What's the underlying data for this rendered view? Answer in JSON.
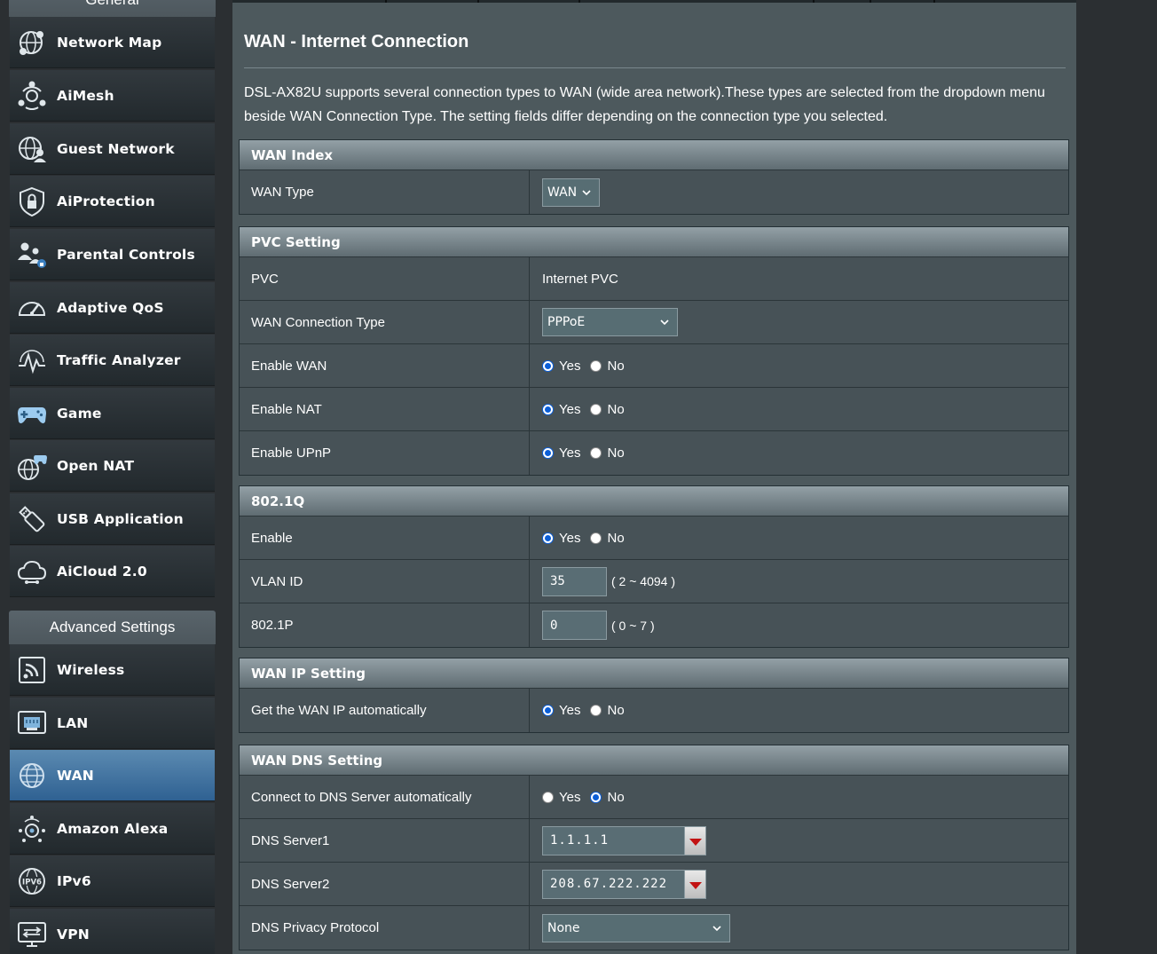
{
  "sidebar": {
    "general_header": "General",
    "advanced_header": "Advanced Settings",
    "general_items": [
      {
        "label": "Network Map",
        "icon": "network-map-icon"
      },
      {
        "label": "AiMesh",
        "icon": "aimesh-icon"
      },
      {
        "label": "Guest Network",
        "icon": "guest-network-icon"
      },
      {
        "label": "AiProtection",
        "icon": "shield-lock-icon"
      },
      {
        "label": "Parental Controls",
        "icon": "parental-controls-icon"
      },
      {
        "label": "Adaptive QoS",
        "icon": "speedometer-icon"
      },
      {
        "label": "Traffic Analyzer",
        "icon": "traffic-analyzer-icon"
      },
      {
        "label": "Game",
        "icon": "gamepad-icon"
      },
      {
        "label": "Open NAT",
        "icon": "open-nat-icon"
      },
      {
        "label": "USB Application",
        "icon": "usb-icon"
      },
      {
        "label": "AiCloud 2.0",
        "icon": "cloud-icon"
      }
    ],
    "advanced_items": [
      {
        "label": "Wireless",
        "icon": "wireless-icon"
      },
      {
        "label": "LAN",
        "icon": "lan-icon"
      },
      {
        "label": "WAN",
        "icon": "globe-icon",
        "active": true
      },
      {
        "label": "Amazon Alexa",
        "icon": "alexa-icon"
      },
      {
        "label": "IPv6",
        "icon": "ipv6-icon"
      },
      {
        "label": "VPN",
        "icon": "vpn-icon"
      }
    ]
  },
  "main": {
    "title": "WAN - Internet Connection",
    "description": "DSL-AX82U supports several connection types to WAN (wide area network).These types are selected from the dropdown menu beside WAN Connection Type. The setting fields differ depending on the connection type you selected."
  },
  "radio_labels": {
    "yes": "Yes",
    "no": "No"
  },
  "wan_index": {
    "header": "WAN Index",
    "wan_type_label": "WAN Type",
    "wan_type_value": "WAN"
  },
  "pvc_setting": {
    "header": "PVC Setting",
    "pvc_label": "PVC",
    "pvc_value": "Internet PVC",
    "conn_type_label": "WAN Connection Type",
    "conn_type_value": "PPPoE",
    "enable_wan_label": "Enable WAN",
    "enable_wan": "yes",
    "enable_nat_label": "Enable NAT",
    "enable_nat": "yes",
    "enable_upnp_label": "Enable UPnP",
    "enable_upnp": "yes"
  },
  "dot1q": {
    "header": "802.1Q",
    "enable_label": "Enable",
    "enable": "yes",
    "vlan_label": "VLAN ID",
    "vlan_value": "35",
    "vlan_hint": "( 2 ~ 4094 )",
    "p_label": "802.1P",
    "p_value": "0",
    "p_hint": "( 0 ~ 7 )"
  },
  "wan_ip": {
    "header": "WAN IP Setting",
    "auto_label": "Get the WAN IP automatically",
    "auto": "yes"
  },
  "wan_dns": {
    "header": "WAN DNS Setting",
    "auto_label": "Connect to DNS Server automatically",
    "auto": "no",
    "dns1_label": "DNS Server1",
    "dns1_value": "1.1.1.1",
    "dns2_label": "DNS Server2",
    "dns2_value": "208.67.222.222",
    "privacy_label": "DNS Privacy Protocol",
    "privacy_value": "None"
  }
}
